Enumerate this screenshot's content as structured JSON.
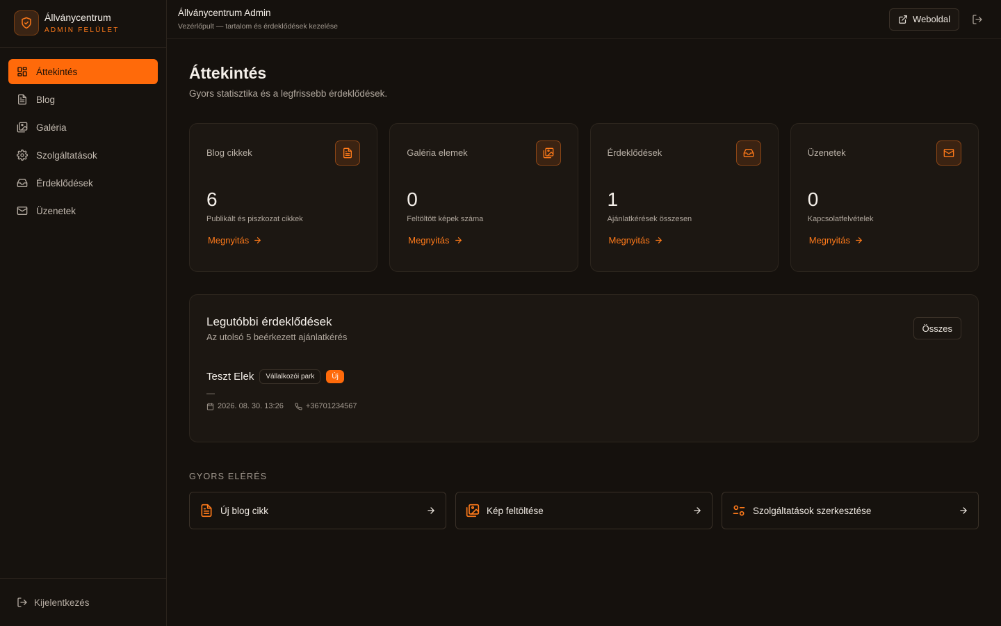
{
  "brand": {
    "name": "Állványcentrum",
    "subtitle": "ADMIN FELÜLET"
  },
  "sidebar": {
    "items": [
      {
        "label": "Áttekintés",
        "icon": "dashboard-icon",
        "active": true
      },
      {
        "label": "Blog",
        "icon": "document-icon",
        "active": false
      },
      {
        "label": "Galéria",
        "icon": "gallery-icon",
        "active": false
      },
      {
        "label": "Szolgáltatások",
        "icon": "gear-icon",
        "active": false
      },
      {
        "label": "Érdeklődések",
        "icon": "inbox-icon",
        "active": false
      },
      {
        "label": "Üzenetek",
        "icon": "mail-icon",
        "active": false
      }
    ],
    "logout_label": "Kijelentkezés"
  },
  "topbar": {
    "title": "Állványcentrum Admin",
    "subtitle": "Vezérlőpult — tartalom és érdeklődések kezelése",
    "website_label": "Weboldal"
  },
  "page": {
    "title": "Áttekintés",
    "subtitle": "Gyors statisztika és a legfrissebb érdeklődések."
  },
  "stats": [
    {
      "label": "Blog cikkek",
      "value": "6",
      "desc": "Publikált és piszkozat cikkek",
      "link": "Megnyitás",
      "icon": "document-icon"
    },
    {
      "label": "Galéria elemek",
      "value": "0",
      "desc": "Feltöltött képek száma",
      "link": "Megnyitás",
      "icon": "gallery-icon"
    },
    {
      "label": "Érdeklődések",
      "value": "1",
      "desc": "Ajánlatkérések összesen",
      "link": "Megnyitás",
      "icon": "inbox-icon"
    },
    {
      "label": "Üzenetek",
      "value": "0",
      "desc": "Kapcsolatfelvételek",
      "link": "Megnyitás",
      "icon": "mail-icon"
    }
  ],
  "recent": {
    "title": "Legutóbbi érdeklődések",
    "subtitle": "Az utolsó 5 beérkezett ajánlatkérés",
    "all_label": "Összes",
    "items": [
      {
        "name": "Teszt Elek",
        "category": "Vállalkozói park",
        "badge": "Új",
        "note": "—",
        "date": "2026. 08. 30. 13:26",
        "phone": "+36701234567"
      }
    ]
  },
  "quick": {
    "label": "GYORS ELÉRÉS",
    "items": [
      {
        "label": "Új blog cikk",
        "icon": "document-icon"
      },
      {
        "label": "Kép feltöltése",
        "icon": "gallery-icon"
      },
      {
        "label": "Szolgáltatások szerkesztése",
        "icon": "sliders-icon"
      }
    ]
  },
  "colors": {
    "accent": "#ff6a0a",
    "background": "#15110d",
    "card": "#1c1712"
  }
}
